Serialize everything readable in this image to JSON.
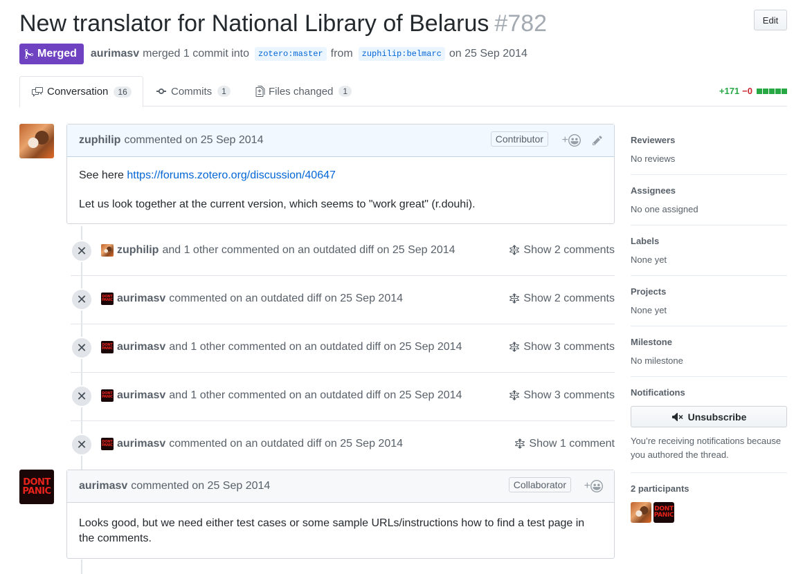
{
  "pr": {
    "title": "New translator for National Library of Belarus",
    "number": "#782",
    "edit_label": "Edit",
    "status": "Merged",
    "author": "aurimasv",
    "merge_text": "merged 1 commit into",
    "base_branch": "zotero:master",
    "from_text": "from",
    "head_branch": "zuphilip:belmarc",
    "date_text": "on 25 Sep 2014"
  },
  "tabs": [
    {
      "label": "Conversation",
      "count": "16"
    },
    {
      "label": "Commits",
      "count": "1"
    },
    {
      "label": "Files changed",
      "count": "1"
    }
  ],
  "diffstat": {
    "additions": "+171",
    "deletions": "−0",
    "color_add": "#28a745",
    "color_del": "#cb2431"
  },
  "comments": [
    {
      "author": "zuphilip",
      "action": "commented on 25 Sep 2014",
      "role": "Contributor",
      "body_prefix": "See here ",
      "link": "https://forums.zotero.org/discussion/40647",
      "body_2": "Let us look together at the current version, which seems to \"work great\" (r.douhi)."
    },
    {
      "author": "aurimasv",
      "action": "commented on 25 Sep 2014",
      "role": "Collaborator",
      "body": "Looks good, but we need either test cases or some sample URLs/instructions how to find a test page in the comments."
    }
  ],
  "events": [
    {
      "author": "zuphilip",
      "text": "and 1 other commented on an outdated diff on 25 Sep 2014",
      "show": "Show 2 comments"
    },
    {
      "author": "aurimasv",
      "text": "commented on an outdated diff on 25 Sep 2014",
      "show": "Show 2 comments"
    },
    {
      "author": "aurimasv",
      "text": "and 1 other commented on an outdated diff on 25 Sep 2014",
      "show": "Show 3 comments"
    },
    {
      "author": "aurimasv",
      "text": "and 1 other commented on an outdated diff on 25 Sep 2014",
      "show": "Show 3 comments"
    },
    {
      "author": "aurimasv",
      "text": "commented on an outdated diff on 25 Sep 2014",
      "show": "Show 1 comment"
    }
  ],
  "avatar_text": {
    "line1": "DONT",
    "line2": "PANIC"
  },
  "sidebar": {
    "reviewers": {
      "title": "Reviewers",
      "value": "No reviews"
    },
    "assignees": {
      "title": "Assignees",
      "value": "No one assigned"
    },
    "labels": {
      "title": "Labels",
      "value": "None yet"
    },
    "projects": {
      "title": "Projects",
      "value": "None yet"
    },
    "milestone": {
      "title": "Milestone",
      "value": "No milestone"
    },
    "notifications": {
      "title": "Notifications",
      "button": "Unsubscribe",
      "reason": "You’re receiving notifications because you authored the thread."
    },
    "participants": {
      "title": "2 participants"
    }
  },
  "colors": {
    "merged": "#6f42c1",
    "link": "#0366d6"
  }
}
